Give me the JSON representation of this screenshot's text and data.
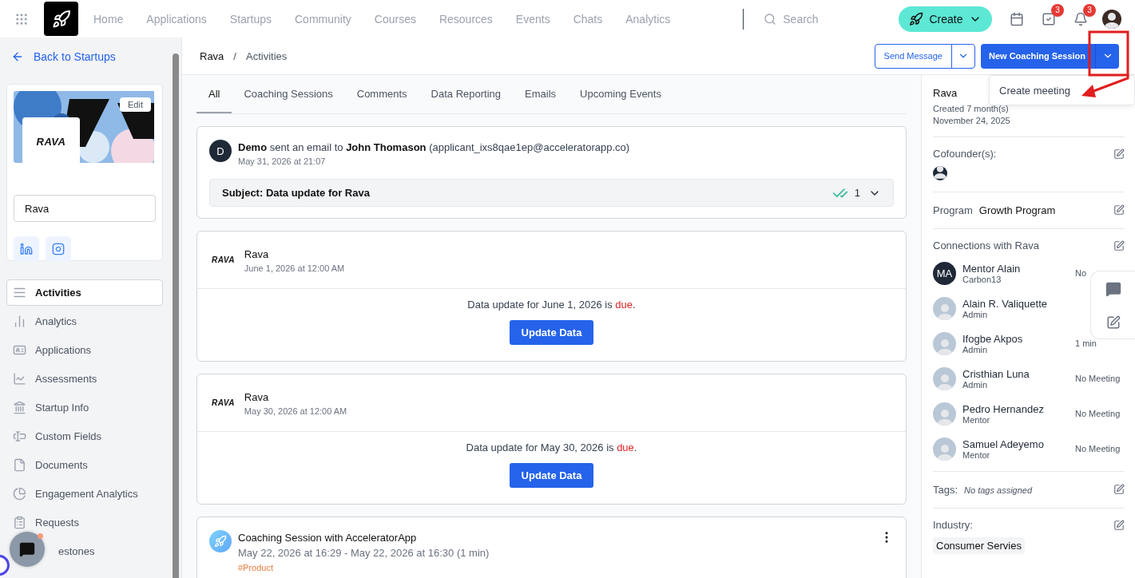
{
  "nav": {
    "items": [
      {
        "label": "Home",
        "selected": false
      },
      {
        "label": "Applications",
        "selected": false
      },
      {
        "label": "Startups",
        "selected": false
      },
      {
        "label": "Community",
        "selected": false
      },
      {
        "label": "Courses",
        "selected": false
      },
      {
        "label": "Resources",
        "selected": false
      },
      {
        "label": "Events",
        "selected": false
      },
      {
        "label": "Chats",
        "selected": false
      },
      {
        "label": "Analytics",
        "selected": false
      }
    ],
    "search": {
      "placeholder": "Search"
    },
    "create_label": "Create",
    "tasks_badge": "3",
    "notifications_badge": "3"
  },
  "sidebar": {
    "back_label": "Back to Startups",
    "edit_label": "Edit",
    "logo_text": "RAVA",
    "name_value": "Rava",
    "items": [
      {
        "label": "Activities",
        "selected": true
      },
      {
        "label": "Analytics",
        "selected": false
      },
      {
        "label": "Applications",
        "selected": false
      },
      {
        "label": "Assessments",
        "selected": false
      },
      {
        "label": "Startup Info",
        "selected": false
      },
      {
        "label": "Custom Fields",
        "selected": false
      },
      {
        "label": "Documents",
        "selected": false
      },
      {
        "label": "Engagement Analytics",
        "selected": false
      },
      {
        "label": "Requests",
        "selected": false
      },
      {
        "label": "estones",
        "selected": false
      }
    ]
  },
  "header": {
    "breadcrumb": [
      "Rava",
      "Activities"
    ],
    "breadcrumb_separator": "/",
    "send_message": "Send Message",
    "new_session": "New Coaching Session",
    "menu": {
      "open": true,
      "items": [
        "Create meeting"
      ]
    }
  },
  "tabs": [
    {
      "label": "All",
      "selected": true
    },
    {
      "label": "Coaching Sessions",
      "selected": false
    },
    {
      "label": "Comments",
      "selected": false
    },
    {
      "label": "Data Reporting",
      "selected": false
    },
    {
      "label": "Emails",
      "selected": false
    },
    {
      "label": "Upcoming Events",
      "selected": false
    }
  ],
  "feed": [
    {
      "kind": "email",
      "initial": "D",
      "text": "**Demo** sent an email to **John Thomason** (applicant_ixs8qae1ep@acceleratorapp.co)",
      "date": "May 31, 2026 at 21:07",
      "subject": "Subject: Data update for Rava",
      "count": "1"
    },
    {
      "kind": "data",
      "logo_text": "RAVA",
      "title": "Rava",
      "date": "June 1, 2026 at 12:00 AM",
      "message": "Data update for June 1, 2026 is **due**.",
      "button": "Update Data"
    },
    {
      "kind": "data",
      "logo_text": "RAVA",
      "title": "Rava",
      "date": "May 30, 2026 at 12:00 AM",
      "message": "Data update for May 30, 2026 is **due**.",
      "button": "Update Data"
    },
    {
      "kind": "session",
      "title": "Coaching Session with AcceleratorApp",
      "date": "May 22, 2026 at 16:29 - May 22, 2026 at 16:30 (1 min)",
      "tag": "#Product"
    }
  ],
  "details": {
    "name": "Rava",
    "created": "Created 7 month(s)",
    "date": "November 24, 2025",
    "cofounders_label": "Cofounder(s):",
    "program_label": "Program",
    "program_value": "Growth Program",
    "connections_label": "Connections with Rava",
    "connections": [
      {
        "name": "Mentor Alain",
        "role": "Carbon13",
        "initials": "MA",
        "meeting": "No"
      },
      {
        "name": "Alain R. Valiquette",
        "role": "Admin"
      },
      {
        "name": "Ifogbe Akpos",
        "role": "Admin",
        "meeting": "1 min"
      },
      {
        "name": "Cristhian Luna",
        "role": "Admin",
        "meeting": "No Meeting"
      },
      {
        "name": "Pedro Hernandez",
        "role": "Mentor",
        "meeting": "No Meeting"
      },
      {
        "name": "Samuel Adeyemo",
        "role": "Mentor",
        "meeting": "No Meeting"
      }
    ],
    "tags_label": "Tags:",
    "tags_value": "No tags assigned",
    "industry_label": "Industry:",
    "industry_value": "Consumer Servies"
  }
}
